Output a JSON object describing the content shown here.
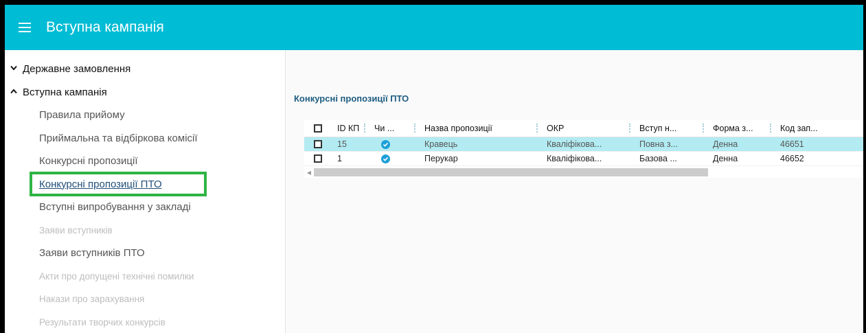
{
  "header": {
    "menu_icon": "hamburger-menu-icon",
    "title": "Вступна кампанія",
    "color": "#00bcd4"
  },
  "sidebar": {
    "groups": [
      {
        "label": "Державне замовлення",
        "icon": "chevron-down-icon",
        "expanded": false
      },
      {
        "label": "Вступна кампанія",
        "icon": "chevron-up-icon",
        "expanded": true
      }
    ],
    "items": [
      {
        "label": "Правила прийому",
        "state": "normal"
      },
      {
        "label": "Приймальна та відбіркова комісії",
        "state": "normal"
      },
      {
        "label": "Конкурсні пропозиції",
        "state": "normal"
      },
      {
        "label": "Конкурсні пропозиції ПТО",
        "state": "active"
      },
      {
        "label": "Вступні випробування у закладі",
        "state": "normal"
      },
      {
        "label": "Заяви вступників",
        "state": "disabled"
      },
      {
        "label": "Заяви вступників ПТО",
        "state": "normal"
      },
      {
        "label": "Акти про допущені технічні помилки",
        "state": "disabled"
      },
      {
        "label": "Накази про зарахування",
        "state": "disabled"
      },
      {
        "label": "Результати творчих конкурсів",
        "state": "disabled"
      }
    ],
    "highlight_color": "#2fb344"
  },
  "main": {
    "section_title": "Конкурсні пропозиції ПТО",
    "grid": {
      "columns": [
        "ID КП",
        "Чи ...",
        "Назва пропозиції",
        "ОКР",
        "Вступ н...",
        "Форма з...",
        "Код зап..."
      ],
      "rows": [
        {
          "id": "15",
          "check_icon": "check-circle-icon",
          "name": "Кравець",
          "okr": "Кваліфікова...",
          "vstup": "Повна з...",
          "forma": "Денна",
          "kod": "46651",
          "selected": true
        },
        {
          "id": "1",
          "check_icon": "check-circle-icon",
          "name": "Перукар",
          "okr": "Кваліфікова...",
          "vstup": "Базова ...",
          "forma": "Денна",
          "kod": "46652",
          "selected": false
        }
      ],
      "selected_row_color": "#b2ebf2"
    }
  }
}
